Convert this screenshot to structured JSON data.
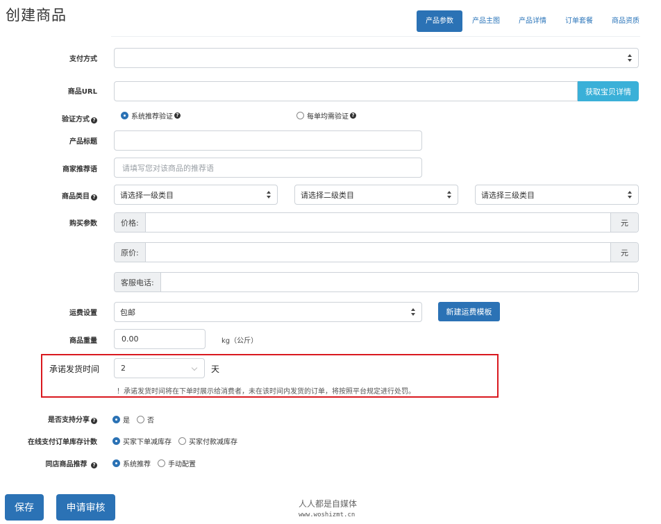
{
  "page": {
    "title": "创建商品"
  },
  "tabs": [
    {
      "label": "产品参数",
      "active": true
    },
    {
      "label": "产品主图",
      "active": false
    },
    {
      "label": "产品详情",
      "active": false
    },
    {
      "label": "订单套餐",
      "active": false
    },
    {
      "label": "商品资质",
      "active": false
    }
  ],
  "form": {
    "payment": {
      "label": "支付方式",
      "value": ""
    },
    "product_url": {
      "label": "商品URL",
      "value": "",
      "button": "获取宝贝详情"
    },
    "verify": {
      "label": "验证方式",
      "options": [
        {
          "label": "系统推荐验证",
          "selected": true
        },
        {
          "label": "每单均需验证",
          "selected": false
        }
      ]
    },
    "product_title": {
      "label": "产品标题",
      "value": ""
    },
    "merchant_recommend": {
      "label": "商家推荐语",
      "placeholder": "请填写您对该商品的推荐语"
    },
    "category": {
      "label": "商品类目",
      "level1": "请选择一级类目",
      "level2": "请选择二级类目",
      "level3": "请选择三级类目"
    },
    "purchase": {
      "label": "购买参数",
      "price_label": "价格:",
      "price_unit": "元",
      "orig_label": "原价:",
      "orig_unit": "元",
      "phone_label": "客服电话:"
    },
    "shipping": {
      "label": "运费设置",
      "value": "包邮",
      "button": "新建运费模板"
    },
    "weight": {
      "label": "商品重量",
      "value": "0.00",
      "unit": "kg（公斤）"
    },
    "promise": {
      "label": "承诺发货时间",
      "value": "2",
      "unit": "天",
      "note": "！承诺发货时间将在下单时展示给消费者，未在该时间内发货的订单，将按照平台规定进行处罚。"
    },
    "share": {
      "label": "是否支持分享",
      "options": [
        {
          "label": "是",
          "selected": true
        },
        {
          "label": "否",
          "selected": false
        }
      ]
    },
    "stock": {
      "label": "在线支付订单库存计数",
      "options": [
        {
          "label": "买家下单减库存",
          "selected": true
        },
        {
          "label": "买家付款减库存",
          "selected": false
        }
      ]
    },
    "same_store": {
      "label": "同店商品推荐",
      "options": [
        {
          "label": "系统推荐",
          "selected": true
        },
        {
          "label": "手动配置",
          "selected": false
        }
      ]
    }
  },
  "footer": {
    "save": "保存",
    "submit": "申请审核"
  },
  "watermark": {
    "line1": "人人都是自媒体",
    "line2": "www.woshizmt.cn"
  },
  "colors": {
    "primary": "#2b72b5",
    "cyan": "#3ab0d8",
    "highlight": "#d9181e"
  }
}
